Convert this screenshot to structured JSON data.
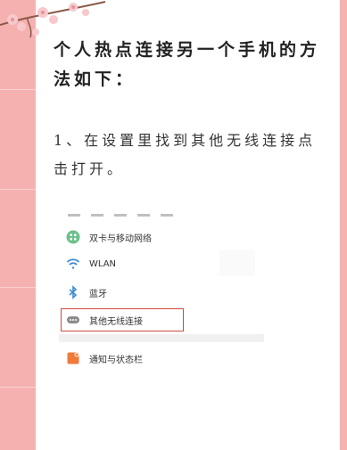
{
  "article": {
    "heading": "个人热点连接另一个手机的方法如下：",
    "step1": "1、在设置里找到其他无线连接点击打开。"
  },
  "settings_menu": {
    "items": [
      {
        "label": "双卡与移动网络",
        "icon": "sim-network-icon"
      },
      {
        "label": "WLAN",
        "icon": "wifi-icon"
      },
      {
        "label": "蓝牙",
        "icon": "bluetooth-icon"
      },
      {
        "label": "其他无线连接",
        "icon": "more-connections-icon",
        "highlighted": true
      },
      {
        "label": "通知与状态栏",
        "icon": "notification-icon"
      }
    ]
  },
  "colors": {
    "background": "#f6b6b4",
    "highlight_border": "#d04a3e",
    "icon_green": "#6cc08a",
    "icon_blue": "#3d8bd9",
    "icon_gray": "#8c8c8c",
    "icon_orange": "#f07a3a"
  }
}
